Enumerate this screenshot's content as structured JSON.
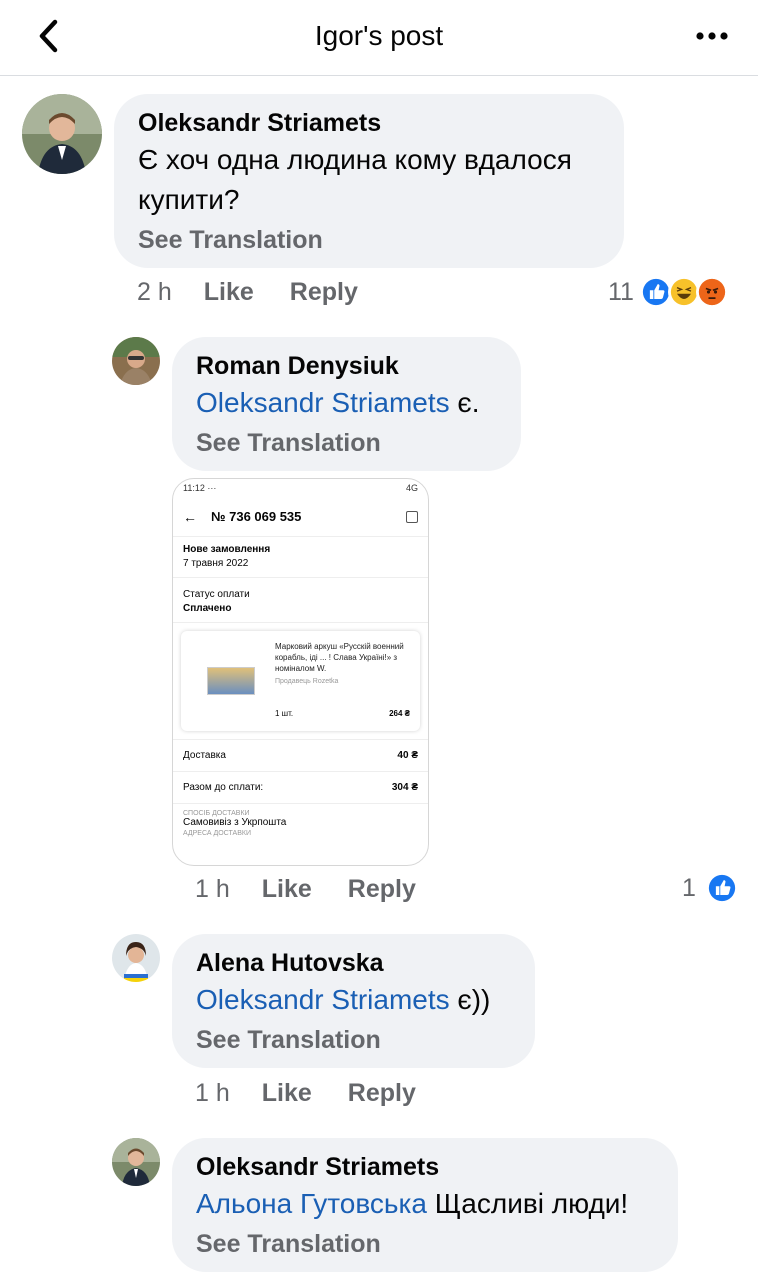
{
  "header": {
    "title": "Igor's post"
  },
  "comments": [
    {
      "author": "Oleksandr Striamets",
      "mention": "",
      "text": "Є хоч одна людина кому вдалося купити?",
      "see_translation": "See Translation",
      "time": "2 h",
      "like": "Like",
      "reply": "Reply",
      "reaction_count": "11"
    },
    {
      "author": "Roman Denysiuk",
      "mention": "Oleksandr Striamets",
      "text": "є.",
      "see_translation": "See Translation",
      "time": "1 h",
      "like": "Like",
      "reply": "Reply",
      "reaction_count": "1"
    },
    {
      "author": "Alena Hutovska",
      "mention": "Oleksandr Striamets",
      "text": "є))",
      "see_translation": "See Translation",
      "time": "1 h",
      "like": "Like",
      "reply": "Reply"
    },
    {
      "author": "Oleksandr Striamets",
      "mention": "Альона Гутовська",
      "text": "Щасливі люди!",
      "see_translation": "See Translation"
    }
  ],
  "attachment": {
    "status_time": "11:12",
    "status_dots": "···",
    "network": "4G",
    "order_number": "№ 736 069 535",
    "order_status": "Нове замовлення",
    "order_date": "7 травня 2022",
    "payment_label": "Статус оплати",
    "payment_value": "Сплачено",
    "product_desc": "Марковий аркуш «Русскій военний корабль, іді ... ! Слава Україні!» з номіналом W.",
    "seller": "Продавець Rozetka",
    "qty": "1 шт.",
    "price": "264 ₴",
    "delivery_label": "Доставка",
    "delivery_value": "40 ₴",
    "total_label": "Разом до сплати:",
    "total_value": "304 ₴",
    "ship_method_label": "СПОСІБ ДОСТАВКИ",
    "ship_method": "Самовивіз з Укрпошта",
    "ship_addr_label": "АДРЕСА ДОСТАВКИ"
  },
  "colors": {
    "mention": "#1a5fb4",
    "bubble": "#f0f2f5",
    "like_blue": "#1877f2"
  }
}
